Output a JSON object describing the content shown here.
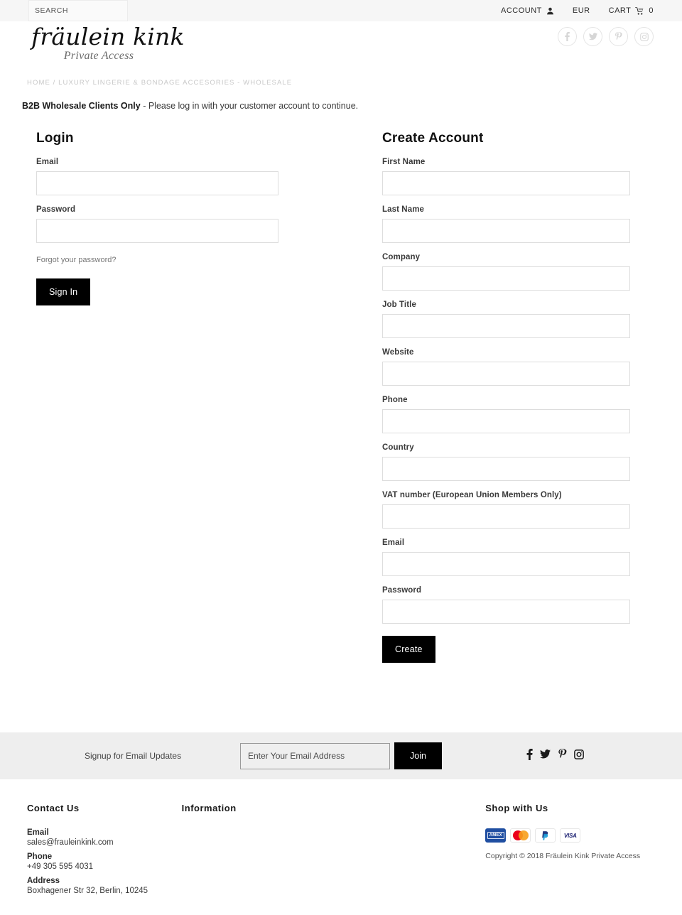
{
  "topbar": {
    "search_placeholder": "SEARCH",
    "account_label": "ACCOUNT",
    "currency_label": "EUR",
    "cart_label": "CART",
    "cart_count": "0"
  },
  "brand": {
    "name": "fräulein kink",
    "tagline": "Private Access"
  },
  "social_top": [
    {
      "name": "facebook",
      "label": "Facebook"
    },
    {
      "name": "twitter",
      "label": "Twitter"
    },
    {
      "name": "pinterest",
      "label": "Pinterest"
    },
    {
      "name": "instagram",
      "label": "Instagram"
    }
  ],
  "breadcrumb": {
    "home": "HOME",
    "separator": " / ",
    "current": "LUXURY LINGERIE & BONDAGE ACCESORIES - WHOLESALE"
  },
  "notice": {
    "bold": "B2B Wholesale Clients Only",
    "rest": " - Please log in with your customer account to continue."
  },
  "login": {
    "title": "Login",
    "email_label": "Email",
    "email_value": "",
    "password_label": "Password",
    "password_value": "",
    "forgot_label": "Forgot your password?",
    "submit_label": "Sign In"
  },
  "create": {
    "title": "Create Account",
    "fields": [
      {
        "label": "First Name",
        "value": "",
        "name": "first-name"
      },
      {
        "label": "Last Name",
        "value": "",
        "name": "last-name"
      },
      {
        "label": "Company",
        "value": "",
        "name": "company"
      },
      {
        "label": "Job Title",
        "value": "",
        "name": "job-title"
      },
      {
        "label": "Website",
        "value": "",
        "name": "website"
      },
      {
        "label": "Phone",
        "value": "",
        "name": "phone"
      },
      {
        "label": "Country",
        "value": "",
        "name": "country"
      },
      {
        "label": "VAT number (European Union Members Only)",
        "value": "",
        "name": "vat-number"
      },
      {
        "label": "Email",
        "value": "",
        "name": "email"
      },
      {
        "label": "Password",
        "value": "",
        "name": "password"
      }
    ],
    "submit_label": "Create"
  },
  "newsletter": {
    "label": "Signup for Email Updates",
    "placeholder": "Enter Your Email Address",
    "value": "",
    "join_label": "Join",
    "social": [
      {
        "name": "facebook",
        "label": "Facebook"
      },
      {
        "name": "twitter",
        "label": "Twitter"
      },
      {
        "name": "pinterest",
        "label": "Pinterest"
      },
      {
        "name": "instagram",
        "label": "Instagram"
      }
    ]
  },
  "footer": {
    "contact": {
      "title": "Contact Us",
      "email_label": "Email",
      "email_value": "sales@frauleinkink.com",
      "phone_label": "Phone",
      "phone_value": "+49 305 595 4031",
      "address_label": "Address",
      "address_value": "Boxhagener Str 32, Berlin, 10245"
    },
    "information": {
      "title": "Information"
    },
    "shop": {
      "title": "Shop with Us",
      "payments": [
        {
          "name": "amex",
          "label": "AMEX"
        },
        {
          "name": "mastercard",
          "label": "Mastercard"
        },
        {
          "name": "paypal",
          "label": "PayPal"
        },
        {
          "name": "visa",
          "label": "VISA"
        }
      ],
      "copyright": "Copyright © 2018 Fräulein Kink Private Access"
    }
  },
  "colors": {
    "accent": "#000000",
    "topbar_bg": "#f6f6f6",
    "newsletter_bg": "#eeeeee",
    "border": "#dddddd",
    "muted_text": "#c8c8c8"
  }
}
